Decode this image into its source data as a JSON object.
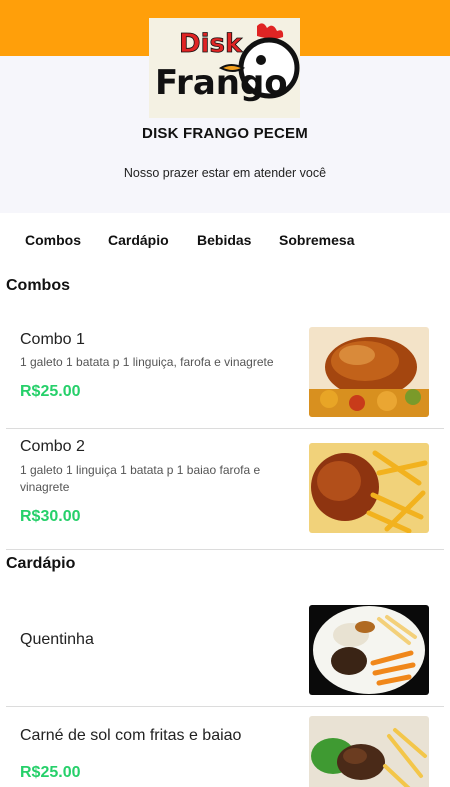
{
  "store": {
    "logo_text_top": "Disk",
    "logo_text_bottom": "Frango",
    "name": "DISK FRANGO PECEM",
    "tagline": "Nosso prazer estar em atender você"
  },
  "nav": {
    "items": [
      {
        "label": "Combos"
      },
      {
        "label": "Cardápio"
      },
      {
        "label": "Bebidas"
      },
      {
        "label": "Sobremesa"
      }
    ]
  },
  "sections": [
    {
      "title": "Combos",
      "items": [
        {
          "name": "Combo 1",
          "description": "1 galeto 1 batata p 1 linguiça, farofa e vinagrete",
          "price": "R$25.00",
          "image": "roast-chicken-image"
        },
        {
          "name": "Combo 2",
          "description": "1 galeto 1 linguiça 1 batata p 1 baiao farofa e vinagrete",
          "price": "R$30.00",
          "image": "chicken-fries-image"
        }
      ]
    },
    {
      "title": "Cardápio",
      "items": [
        {
          "name": "Quentinha",
          "image": "meal-plate-image"
        },
        {
          "name": "Carné de sol com fritas e baiao",
          "price": "R$25.00",
          "image": "beef-fries-image"
        }
      ]
    }
  ],
  "colors": {
    "topbar": "#ff9f0a",
    "header_bg": "#f6f6fb",
    "price": "#26d06a",
    "logo_red": "#e02424"
  }
}
